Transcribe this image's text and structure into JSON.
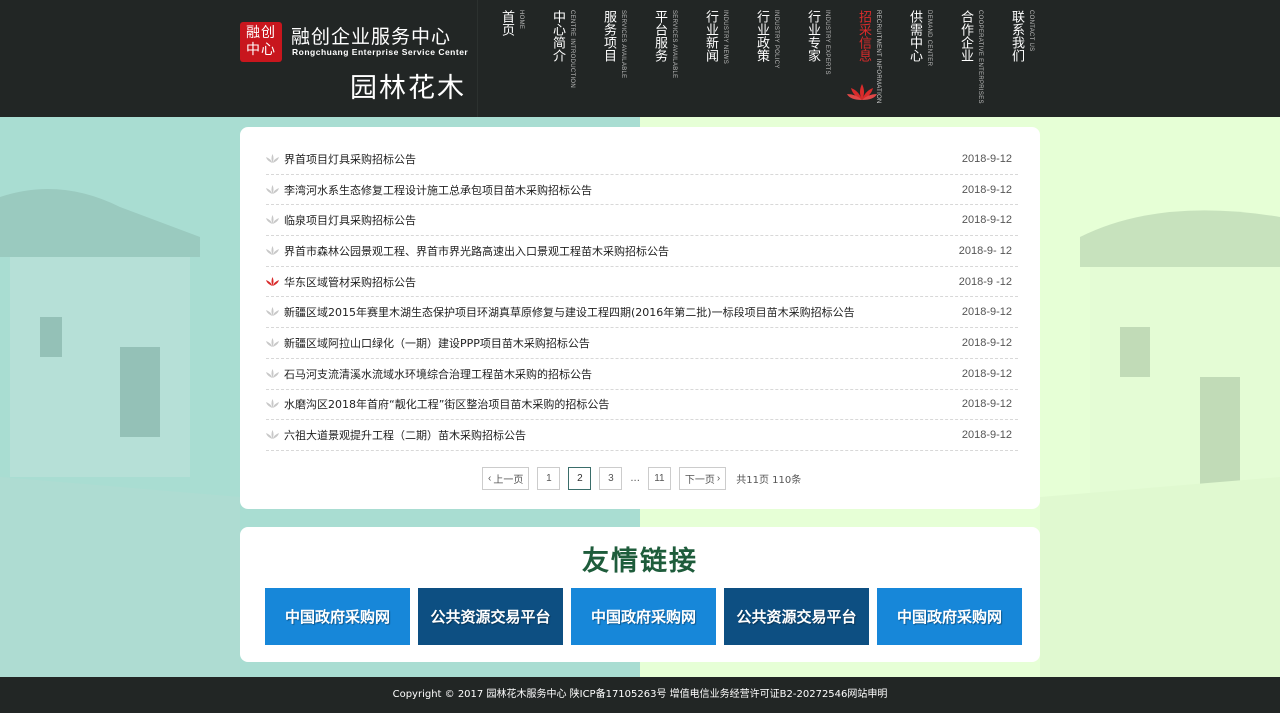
{
  "header": {
    "logo_mark_line1": "融创",
    "logo_mark_line2": "中心",
    "brand_cn": "融创企业服务中心",
    "brand_en": "Rongchuang Enterprise Service Center",
    "site_section": "园林花木"
  },
  "nav": [
    {
      "cn": "首页",
      "en": "HOME"
    },
    {
      "cn": "中心简介",
      "en": "CENTRE INTRODUCTION"
    },
    {
      "cn": "服务项目",
      "en": "SERVICES AVAILABLE"
    },
    {
      "cn": "平台服务",
      "en": "SERVICES AVAILABLE"
    },
    {
      "cn": "行业新闻",
      "en": "INDUSTRY NEWS"
    },
    {
      "cn": "行业政策",
      "en": "INDUSTRY POLICY"
    },
    {
      "cn": "行业专家",
      "en": "INDUSTRY EXPERTS"
    },
    {
      "cn": "招采信息",
      "en": "RECRUITMENT INFORMATION",
      "active": true
    },
    {
      "cn": "供需中心",
      "en": "DEMAND CENTER"
    },
    {
      "cn": "合作企业",
      "en": "COOPERATIVE ENTERPRISES"
    },
    {
      "cn": "联系我们",
      "en": "CONTACT US"
    }
  ],
  "news": [
    {
      "title": "界首项目灯具采购招标公告",
      "date": "2018-9-12"
    },
    {
      "title": "李湾河水系生态修复工程设计施工总承包项目苗木采购招标公告",
      "date": "2018-9-12"
    },
    {
      "title": "临泉项目灯具采购招标公告",
      "date": "2018-9-12"
    },
    {
      "title": "界首市森林公园景观工程、界首市界光路高速出入口景观工程苗木采购招标公告",
      "date": "2018-9- 12"
    },
    {
      "title": "华东区域管材采购招标公告",
      "date": "2018-9 -12",
      "highlight": true
    },
    {
      "title": "新疆区域2015年赛里木湖生态保护项目环湖真草原修复与建设工程四期(2016年第二批)一标段项目苗木采购招标公告",
      "date": "2018-9-12"
    },
    {
      "title": "新疆区域阿拉山口绿化（一期）建设PPP项目苗木采购招标公告",
      "date": "2018-9-12"
    },
    {
      "title": "石马河支流清溪水流域水环境综合治理工程苗木采购的招标公告",
      "date": "2018-9-12"
    },
    {
      "title": "水磨沟区2018年首府“靓化工程”街区整治项目苗木采购的招标公告",
      "date": "2018-9-12"
    },
    {
      "title": "六祖大道景观提升工程（二期）苗木采购招标公告",
      "date": "2018-9-12"
    }
  ],
  "pager": {
    "prev": "上一页",
    "pages": [
      "1",
      "2",
      "3"
    ],
    "current": "2",
    "ellipsis": "...",
    "last": "11",
    "next": "下一页",
    "total": "共11页  110条"
  },
  "links": {
    "title": "友情链接",
    "items": [
      {
        "label": "中国政府采购网",
        "color": "#1787d9"
      },
      {
        "label": "公共资源交易平台",
        "color": "#0d4f82"
      },
      {
        "label": "中国政府采购网",
        "color": "#1787d9"
      },
      {
        "label": "公共资源交易平台",
        "color": "#0d4f82"
      },
      {
        "label": "中国政府采购网",
        "color": "#1787d9"
      }
    ]
  },
  "footer": {
    "text": "Copyright © 2017    园林花木服务中心    陕ICP备17105263号 增值电信业务经营许可证B2-20272546网站申明"
  },
  "colors": {
    "header_bg": "#222625",
    "accent_red": "#c8161d",
    "bg_left": "#a9ddd2",
    "bg_right": "#e6ffd6",
    "links_title": "#1e5c3b"
  }
}
